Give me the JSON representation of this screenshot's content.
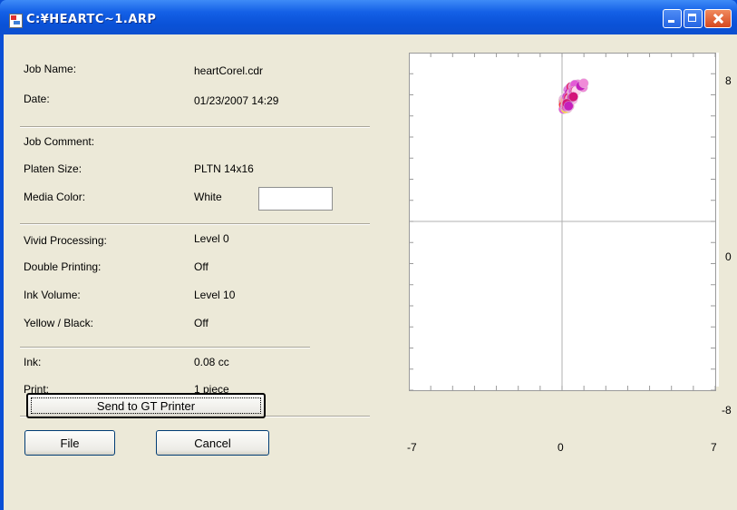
{
  "window": {
    "title": "C:¥HEARTC~1.ARP"
  },
  "fields": {
    "job_name_label": "Job Name:",
    "job_name_value": "heartCorel.cdr",
    "date_label": "Date:",
    "date_value": "01/23/2007 14:29",
    "job_comment_label": "Job Comment:",
    "platen_size_label": "Platen Size:",
    "platen_size_value": "PLTN 14x16",
    "media_color_label": "Media Color:",
    "media_color_value": "White",
    "media_color_swatch": "#ffffff",
    "vivid_label": "Vivid Processing:",
    "vivid_value": "Level 0",
    "double_label": "Double Printing:",
    "double_value": "Off",
    "ink_volume_label": "Ink Volume:",
    "ink_volume_value": "Level 10",
    "yellow_black_label": "Yellow / Black:",
    "yellow_black_value": "Off",
    "ink_label": "Ink:",
    "ink_value": "0.08 cc",
    "print_label": "Print:",
    "print_value": "1 piece"
  },
  "buttons": {
    "send": "Send to GT Printer",
    "file": "File",
    "cancel": "Cancel"
  },
  "plot": {
    "x_ticks": [
      "-7",
      "0",
      "7"
    ],
    "y_ticks": [
      "8",
      "0",
      "-8"
    ],
    "xlim": [
      -7,
      7
    ],
    "ylim": [
      -8,
      8
    ],
    "heart_colors": [
      "#e060e0",
      "#f08ad8",
      "#c51fbd",
      "#ff66b3",
      "#e61f6e",
      "#f5a3a3",
      "#ffd6ec",
      "#e35bd6",
      "#d4147a",
      "#f7b7e8",
      "#ff3333",
      "#ffdd33",
      "#ffffff",
      "#cc44cc"
    ]
  }
}
